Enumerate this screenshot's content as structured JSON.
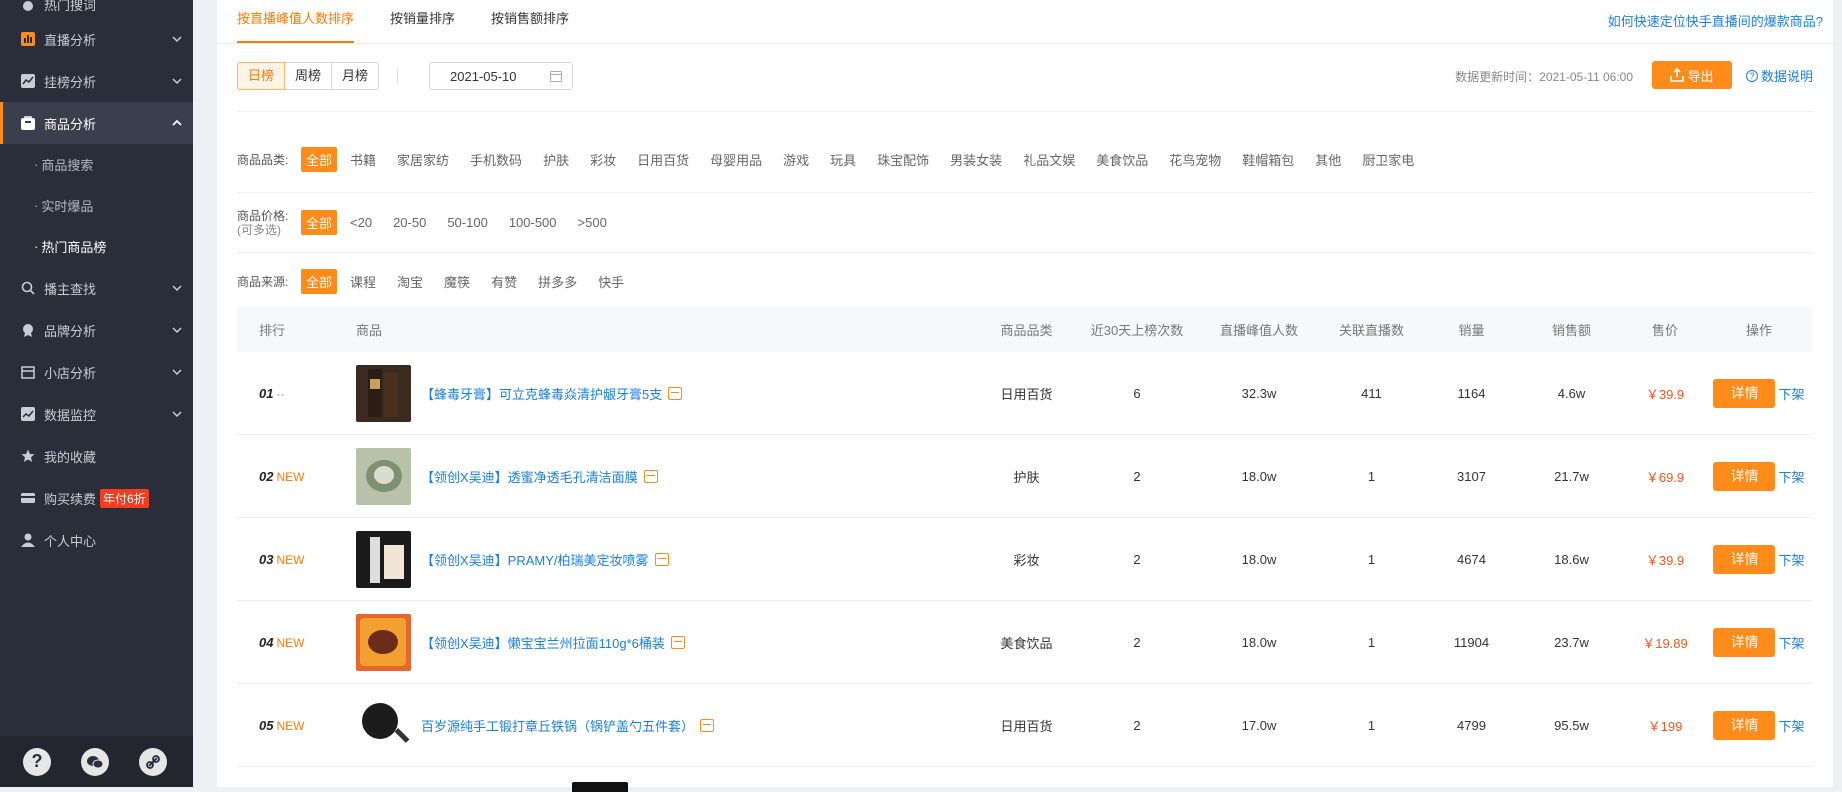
{
  "sidebar": {
    "items": [
      {
        "label": "热门搜词",
        "icon": "circle-icon"
      },
      {
        "label": "直播分析",
        "icon": "bar-chart-icon"
      },
      {
        "label": "挂榜分析",
        "icon": "line-chart-icon"
      },
      {
        "label": "商品分析",
        "icon": "bag-icon"
      },
      {
        "label": "播主查找",
        "icon": "search-icon"
      },
      {
        "label": "品牌分析",
        "icon": "medal-icon"
      },
      {
        "label": "小店分析",
        "icon": "store-icon"
      },
      {
        "label": "数据监控",
        "icon": "monitor-icon"
      },
      {
        "label": "我的收藏",
        "icon": "star-icon"
      },
      {
        "label": "购买续费",
        "icon": "card-icon",
        "badge": "年付6折"
      },
      {
        "label": "个人中心",
        "icon": "user-icon"
      }
    ],
    "sub_items": [
      "商品搜索",
      "实时爆品",
      "热门商品榜"
    ]
  },
  "tabs": [
    "按直播峰值人数排序",
    "按销量排序",
    "按销售额排序"
  ],
  "help_link": "如何快速定位快手直播间的爆款商品?",
  "toolbar": {
    "periods": [
      "日榜",
      "周榜",
      "月榜"
    ],
    "date": "2021-05-10",
    "update_text": "数据更新时间：2021-05-11 06:00",
    "export_label": "导出",
    "doc_label": "数据说明"
  },
  "filters": {
    "category_label": "商品品类:",
    "categories": [
      "全部",
      "书籍",
      "家居家纺",
      "手机数码",
      "护肤",
      "彩妆",
      "日用百货",
      "母婴用品",
      "游戏",
      "玩具",
      "珠宝配饰",
      "男装女装",
      "礼品文娱",
      "美食饮品",
      "花鸟宠物",
      "鞋帽箱包",
      "其他",
      "厨卫家电"
    ],
    "price_label": "商品价格:",
    "price_note": "(可多选)",
    "prices": [
      "全部",
      "<20",
      "20-50",
      "50-100",
      "100-500",
      ">500"
    ],
    "source_label": "商品来源:",
    "sources": [
      "全部",
      "课程",
      "淘宝",
      "魔筷",
      "有赞",
      "拼多多",
      "快手"
    ]
  },
  "table": {
    "headers": [
      "排行",
      "商品",
      "商品品类",
      "近30天上榜次数",
      "直播峰值人数",
      "关联直播数",
      "销量",
      "销售额",
      "售价",
      "操作"
    ],
    "detail_label": "详情",
    "down_label": "下架",
    "rows": [
      {
        "rank": "01",
        "tag": "--",
        "name": "【蜂毒牙膏】可立克蜂毒焱清护龈牙膏5支",
        "category": "日用百货",
        "times": "6",
        "peak": "32.3w",
        "related": "411",
        "sales": "1164",
        "amount": "4.6w",
        "price": "￥39.9",
        "thumb_color": "#3b2a20"
      },
      {
        "rank": "02",
        "tag": "NEW",
        "name": "【领创X吴迪】透蜜净透毛孔清洁面膜",
        "category": "护肤",
        "times": "2",
        "peak": "18.0w",
        "related": "1",
        "sales": "3107",
        "amount": "21.7w",
        "price": "￥69.9",
        "thumb_color": "#b8c2a8"
      },
      {
        "rank": "03",
        "tag": "NEW",
        "name": "【领创X吴迪】PRAMY/柏瑞美定妆喷雾",
        "category": "彩妆",
        "times": "2",
        "peak": "18.0w",
        "related": "1",
        "sales": "4674",
        "amount": "18.6w",
        "price": "￥39.9",
        "thumb_color": "#1a1a1a"
      },
      {
        "rank": "04",
        "tag": "NEW",
        "name": "【领创X吴迪】懒宝宝兰州拉面110g*6桶装",
        "category": "美食饮品",
        "times": "2",
        "peak": "18.0w",
        "related": "1",
        "sales": "11904",
        "amount": "23.7w",
        "price": "￥19.89",
        "thumb_color": "#e8662a"
      },
      {
        "rank": "05",
        "tag": "NEW",
        "name": "百岁源纯手工锻打章丘铁锅（锅铲盖勺五件套）",
        "category": "日用百货",
        "times": "2",
        "peak": "17.0w",
        "related": "1",
        "sales": "4799",
        "amount": "95.5w",
        "price": "￥199",
        "thumb_color": "#ffffff"
      }
    ]
  }
}
